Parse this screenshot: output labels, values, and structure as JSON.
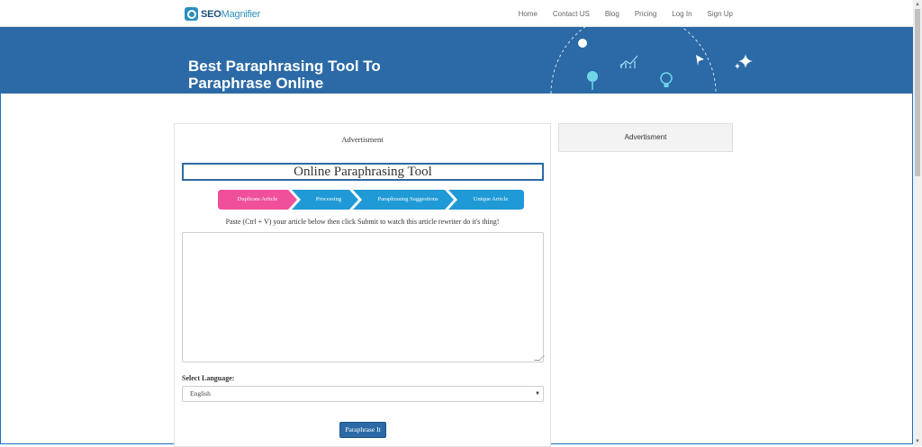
{
  "brand": {
    "seo": "SEO",
    "magnifier": "Magnifier"
  },
  "nav": {
    "items": [
      {
        "label": "Home"
      },
      {
        "label": "Contact US"
      },
      {
        "label": "Blog"
      },
      {
        "label": "Pricing"
      },
      {
        "label": "Log In"
      },
      {
        "label": "Sign Up"
      }
    ]
  },
  "hero": {
    "title_line1": "Best Paraphrasing Tool To",
    "title_line2": "Paraphrase Online",
    "icons": [
      "chart-icon",
      "lightbulb-icon",
      "paper-plane-icon",
      "sparkle-icon",
      "pin-icon"
    ]
  },
  "main": {
    "ad_label": "Advertisment",
    "tool_title": "Online Paraphrasing Tool",
    "steps": [
      {
        "label": "Duplicate Article",
        "color": "#ef4f9b"
      },
      {
        "label": "Processing",
        "color": "#1f9ad6"
      },
      {
        "label": "Paraphrasing Suggestions",
        "color": "#1f9ad6"
      },
      {
        "label": "Unique Article",
        "color": "#1f9ad6"
      }
    ],
    "instruction": "Paste (Ctrl + V) your article below then click Submit to watch this article rewriter do it's thing!",
    "textarea_value": "",
    "language_label": "Select Language:",
    "language_selected": "English",
    "submit_label": "Paraphrase It"
  },
  "sidebar": {
    "ad_label": "Advertisment"
  },
  "colors": {
    "hero_bg": "#2b6aa6",
    "accent": "#1f9ad6",
    "pink": "#ef4f9b"
  }
}
